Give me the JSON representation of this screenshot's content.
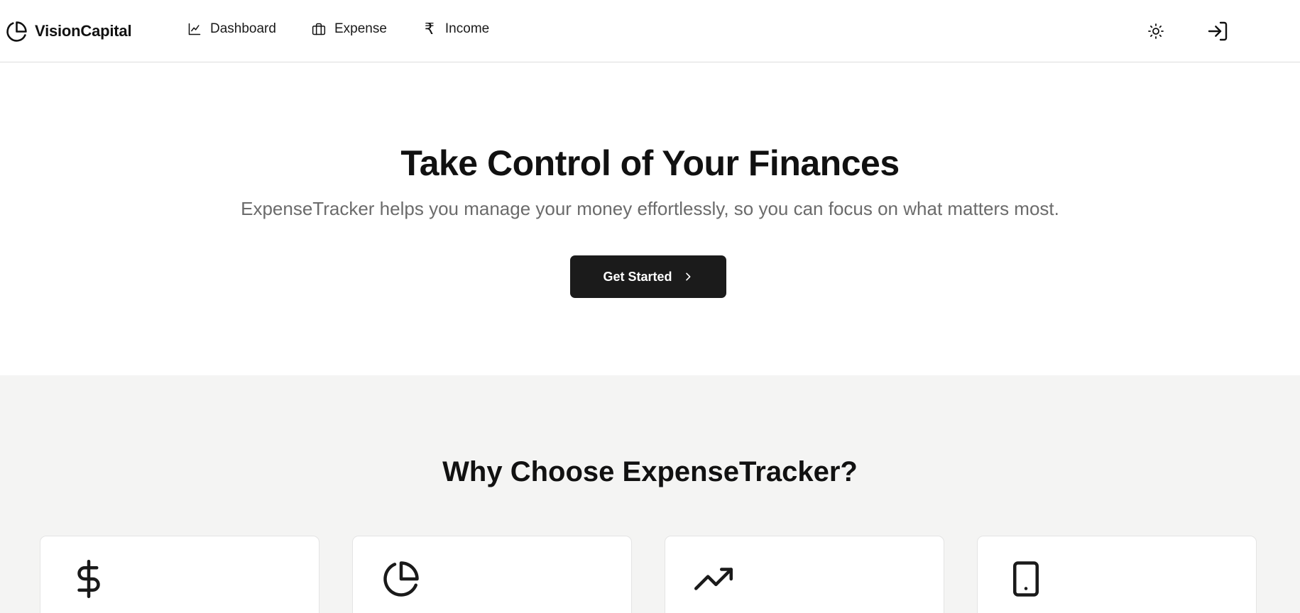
{
  "brand": {
    "name": "VisionCapital",
    "icon": "pie-chart-icon"
  },
  "nav": {
    "items": [
      {
        "label": "Dashboard",
        "icon": "line-chart-icon"
      },
      {
        "label": "Expense",
        "icon": "briefcase-icon"
      },
      {
        "label": "Income",
        "icon": "rupee-icon"
      }
    ]
  },
  "header_actions": {
    "theme_icon": "sun-icon",
    "login_icon": "login-icon"
  },
  "hero": {
    "title": "Take Control of Your Finances",
    "subtitle": "ExpenseTracker helps you manage your money effortlessly, so you can focus on what matters most.",
    "cta_label": "Get Started"
  },
  "features": {
    "title": "Why Choose ExpenseTracker?",
    "cards": [
      {
        "icon": "dollar-icon"
      },
      {
        "icon": "pie-chart-icon"
      },
      {
        "icon": "trending-up-icon"
      },
      {
        "icon": "smartphone-icon"
      }
    ]
  },
  "colors": {
    "primary": "#1b1b1b",
    "muted_text": "#6b6b6b",
    "section_bg": "#f4f4f3",
    "border": "#dedede"
  }
}
